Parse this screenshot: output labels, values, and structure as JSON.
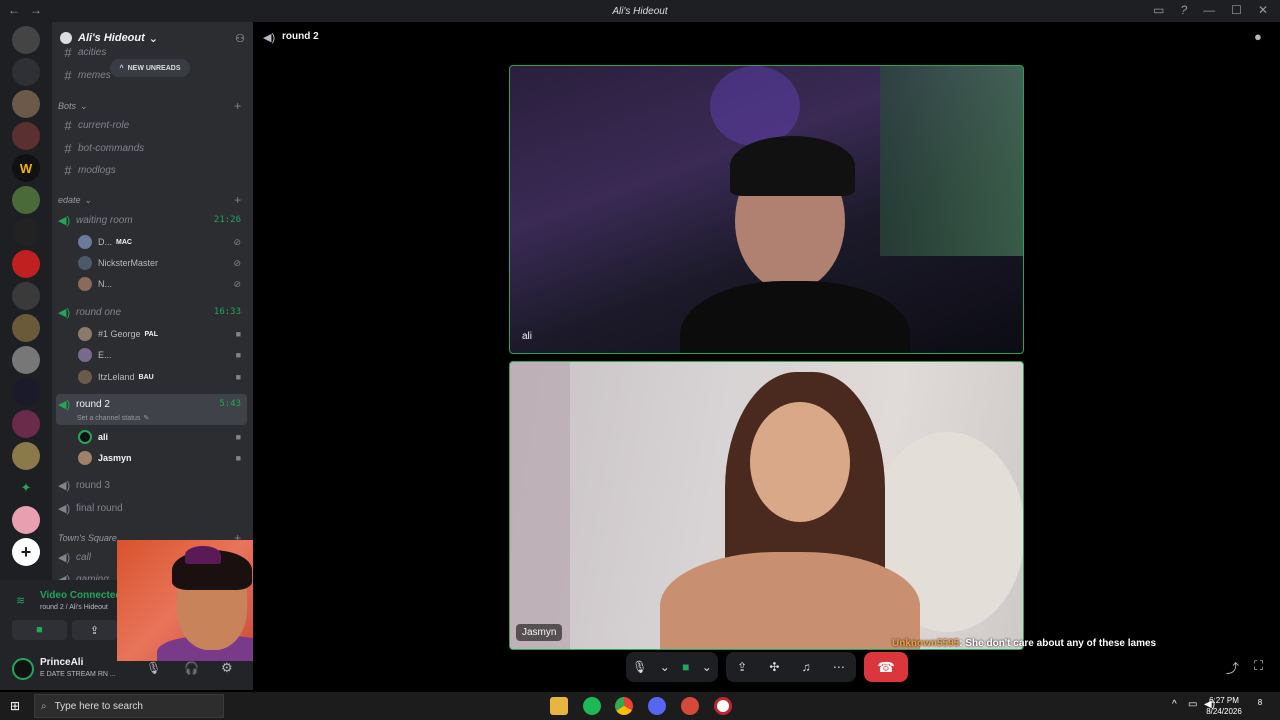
{
  "window": {
    "title": "Ali's Hideout"
  },
  "server": {
    "name": "Ali's Hideout"
  },
  "new_unreads": "NEW UNREADS",
  "sidebar": {
    "top_channels": [
      "acities",
      "memes"
    ],
    "categories": [
      {
        "name": "Bots",
        "channels": [
          "current-role",
          "bot-commands",
          "modlogs"
        ]
      },
      {
        "name": "edate",
        "channels": []
      },
      {
        "name": "Town's Square",
        "channels": [
          "call",
          "gaming"
        ]
      }
    ],
    "voice": [
      {
        "name": "waiting room",
        "timer": "21:26",
        "users": [
          {
            "name": "D...",
            "tag": "MAC"
          },
          {
            "name": "NicksterMaster",
            "tag": ""
          },
          {
            "name": "N...",
            "tag": ""
          }
        ]
      },
      {
        "name": "round one",
        "timer": "16:33",
        "users": [
          {
            "name": "#1 George",
            "tag": "PAL"
          },
          {
            "name": "E...",
            "tag": ""
          },
          {
            "name": "ItzLeland",
            "tag": "BAU"
          }
        ]
      },
      {
        "name": "round 2",
        "timer": "5:43",
        "status": "Set a channel status",
        "users": [
          {
            "name": "ali",
            "tag": ""
          },
          {
            "name": "Jasmyn",
            "tag": ""
          }
        ]
      },
      {
        "name": "round 3"
      },
      {
        "name": "final round"
      }
    ]
  },
  "voice_panel": {
    "status": "Video Connected",
    "location": "round 2 / Ali's Hideout"
  },
  "user_panel": {
    "name": "PrinceAli",
    "status": "E DATE STREAM RN ..."
  },
  "main": {
    "channel": "round 2",
    "tiles": [
      {
        "name": "ali"
      },
      {
        "name": "Jasmyn"
      }
    ]
  },
  "overlay": {
    "user": "Unknown5595",
    "message": ": She don't care about any of these lames"
  },
  "taskbar": {
    "search_placeholder": "Type here to search",
    "time": "6:27 PM",
    "date": "8/24/2026",
    "notifications": "8"
  },
  "colors": {
    "accent_green": "#23a55a",
    "hangup_red": "#da373c"
  }
}
